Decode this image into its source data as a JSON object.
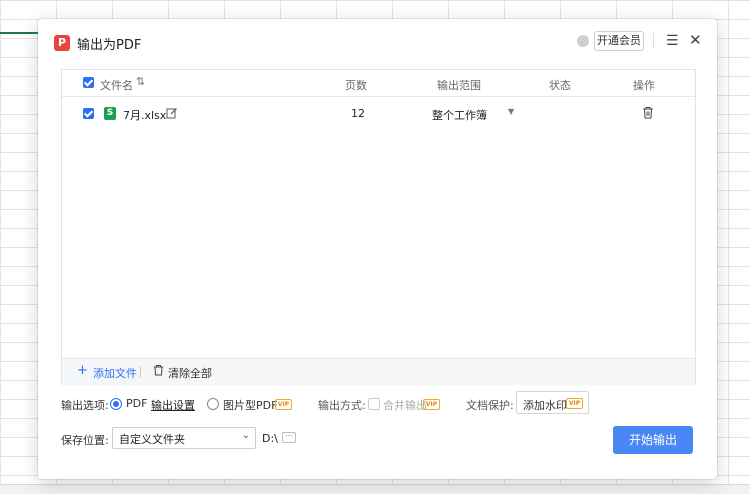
{
  "dialog": {
    "title": "输出为PDF",
    "vip_button": "开通会员"
  },
  "table": {
    "columns": {
      "filename": "文件名",
      "pages": "页数",
      "range": "输出范围",
      "status": "状态",
      "actions": "操作"
    },
    "rows": [
      {
        "checked": true,
        "filename": "7月.xlsx",
        "pages": "12",
        "range": "整个工作簿",
        "status": ""
      }
    ],
    "footer": {
      "add_file": "添加文件",
      "clear_all": "清除全部"
    }
  },
  "options": {
    "label": "输出选项:",
    "pdf": "PDF",
    "settings_link": "输出设置",
    "image_pdf": "图片型PDF",
    "vip": "VIP",
    "method_label": "输出方式:",
    "merge": "合并输出",
    "protect_label": "文档保护:",
    "watermark": "添加水印"
  },
  "save": {
    "label": "保存位置:",
    "folder": "自定义文件夹",
    "path": "D:\\",
    "more": "···"
  },
  "actions": {
    "start": "开始输出"
  },
  "colors": {
    "accent": "#2b6ff5",
    "primary_button": "#4a86f5",
    "title_icon": "#e8453c",
    "excel_icon": "#1e9e52",
    "vip_badge": "#f0a830"
  }
}
